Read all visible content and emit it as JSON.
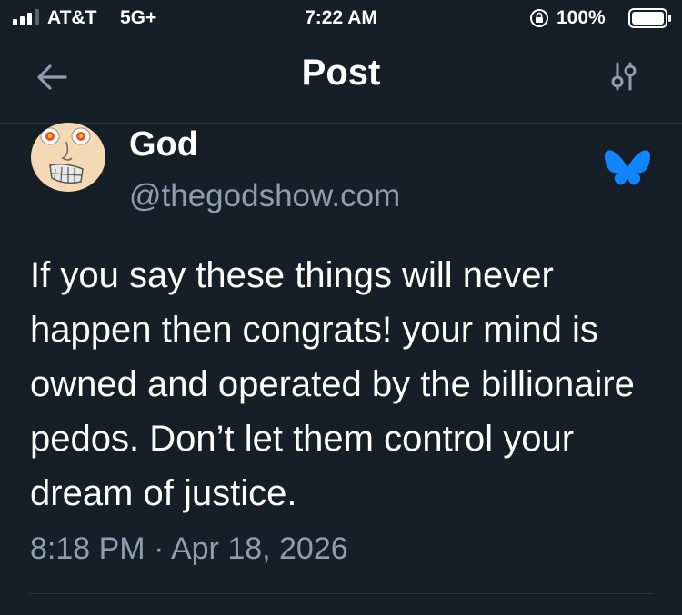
{
  "status_bar": {
    "carrier": "AT&T",
    "network": "5G+",
    "time": "7:22 AM",
    "battery_percent": "100%",
    "icons": [
      "signal-icon",
      "orientation-lock-icon",
      "battery-icon"
    ]
  },
  "nav": {
    "title": "Post",
    "icons": [
      "back-arrow-icon",
      "sliders-icon"
    ]
  },
  "post": {
    "author_name": "God",
    "author_handle": "@thegodshow.com",
    "text": "If you say these things will never happen then congrats! your mind is owned and operated by the billionaire pedos. Don’t let them control your dream of justice.",
    "timestamp": "8:18 PM · Apr 18, 2026",
    "icons": [
      "avatar",
      "bluesky-butterfly-icon"
    ]
  },
  "colors": {
    "background": "#161e27",
    "secondary_text": "#8f9db0",
    "accent_blue": "#1185fe",
    "divider": "#2b3440"
  }
}
